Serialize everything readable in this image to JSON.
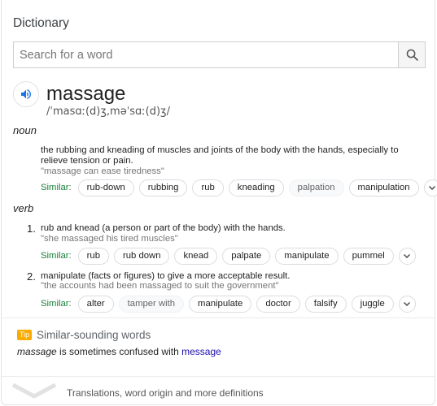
{
  "card_title": "Dictionary",
  "search": {
    "placeholder": "Search for a word"
  },
  "entry": {
    "word": "massage",
    "phonetic": "/ˈmasɑː(d)ʒ,məˈsɑː(d)ʒ/"
  },
  "noun": {
    "label": "noun",
    "definition": "the rubbing and kneading of muscles and joints of the body with the hands, especially to relieve tension or pain.",
    "example": "\"massage can ease tiredness\"",
    "similar_label": "Similar:",
    "similar": [
      "rub-down",
      "rubbing",
      "rub",
      "kneading",
      "palpation",
      "manipulation"
    ]
  },
  "verb": {
    "label": "verb",
    "senses": [
      {
        "num": "1.",
        "definition": "rub and knead (a person or part of the body) with the hands.",
        "example": "\"she massaged his tired muscles\"",
        "similar_label": "Similar:",
        "similar": [
          "rub",
          "rub down",
          "knead",
          "palpate",
          "manipulate",
          "pummel"
        ]
      },
      {
        "num": "2.",
        "definition": "manipulate (facts or figures) to give a more acceptable result.",
        "example": "\"the accounts had been massaged to suit the government\"",
        "similar_label": "Similar:",
        "similar": [
          "alter",
          "tamper with",
          "manipulate",
          "doctor",
          "falsify",
          "juggle"
        ]
      }
    ]
  },
  "similar_sounding": {
    "badge": "Tip",
    "title": "Similar-sounding words",
    "word": "massage",
    "middle": " is sometimes confused with ",
    "link": "message"
  },
  "more": {
    "label": "Translations, word origin and more definitions"
  },
  "colors": {
    "similar_label": "#188038",
    "link": "#1a0dab",
    "tip": "#f9ab00",
    "speaker": "#1a73e8"
  }
}
